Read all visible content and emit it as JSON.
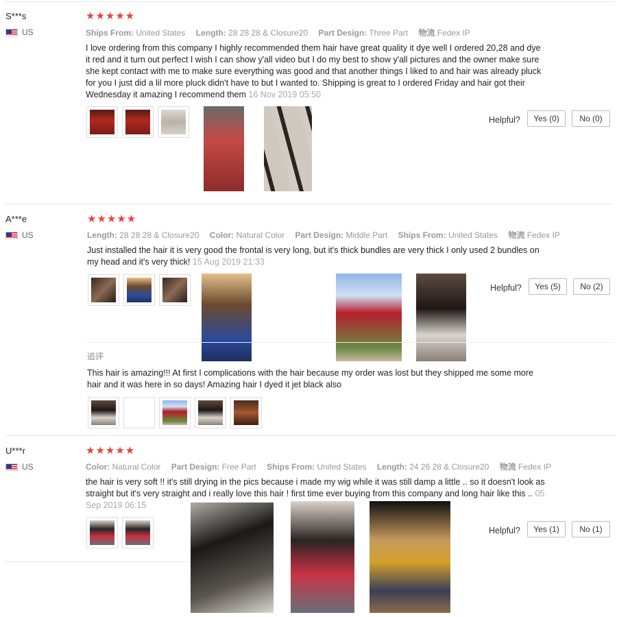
{
  "helpful_label": "Helpful?",
  "reviews": [
    {
      "user": "S***s",
      "country": "US",
      "stars": "★★★★★",
      "meta": [
        {
          "k": "Ships From:",
          "v": "United States"
        },
        {
          "k": "Length:",
          "v": "28 28 28 & Closure20"
        },
        {
          "k": "Part Design:",
          "v": "Three Part"
        },
        {
          "k": "物流",
          "v": "Fedex IP"
        }
      ],
      "text": "I love ordering from this company I highly recommended them hair have great quality it dye well I ordered 20,28 and dye it red and it turn out perfect I wish I can show y'all video but I do my best to show y'all pictures and the owner make sure she kept contact with me to make sure everything was good and that another things I liked to and hair was already pluck for you I just did a lil more pluck didn't have to but I wanted to. Shipping is great to I ordered Friday and hair got their Wednesday it amazing I recommend them",
      "date": "16 Nov 2019 05:50",
      "yes": "Yes (0)",
      "no": "No (0)"
    },
    {
      "user": "A***e",
      "country": "US",
      "stars": "★★★★★",
      "meta": [
        {
          "k": "Length:",
          "v": "28 28 28 & Closure20"
        },
        {
          "k": "Color:",
          "v": "Natural Color"
        },
        {
          "k": "Part Design:",
          "v": "Middle Part"
        },
        {
          "k": "Ships From:",
          "v": "United States"
        },
        {
          "k": "物流",
          "v": "Fedex IP"
        }
      ],
      "text": "Just installed the hair it is very good the frontal is very long, but it's thick bundles are very thick I only used 2 bundles on my head and it's very thick!",
      "date": "15 Aug 2019 21:33",
      "yes": "Yes (5)",
      "no": "No (2)",
      "followup_label": "追评",
      "followup_text": "This hair is amazing!!! At first I complications with the hair because my order was lost but they shipped me some more hair and it was here in so days! Amazing hair I dyed it jet black also"
    },
    {
      "user": "U***r",
      "country": "US",
      "stars": "★★★★★",
      "meta": [
        {
          "k": "Color:",
          "v": "Natural Color"
        },
        {
          "k": "Part Design:",
          "v": "Free Part"
        },
        {
          "k": "Ships From:",
          "v": "United States"
        },
        {
          "k": "Length:",
          "v": "24 26 28 & Closure20"
        },
        {
          "k": "物流",
          "v": "Fedex IP"
        }
      ],
      "text": "the hair is very soft !! it's still drying in the pics because i made my wig while it was still damp a little .. so it doesn't look as straight but it's very straight and i really love this hair ! first time ever buying from this company and long hair like this ..",
      "date": "05 Sep 2019 06:15",
      "yes": "Yes (1)",
      "no": "No (1)"
    }
  ]
}
